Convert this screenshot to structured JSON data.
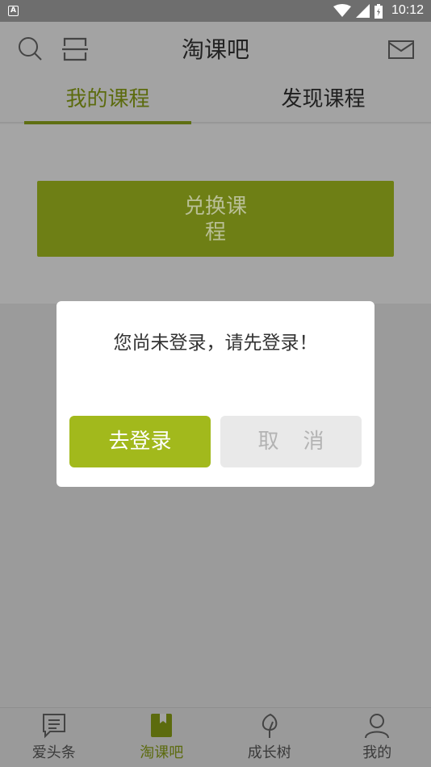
{
  "status_bar": {
    "app_indicator": "A",
    "time": "10:12",
    "icons": [
      "wifi-icon",
      "signal-icon",
      "battery-icon"
    ]
  },
  "header": {
    "title": "淘课吧",
    "left_icons": [
      "search-icon",
      "scan-icon"
    ],
    "right_icon": "mail-icon"
  },
  "tabs": [
    {
      "label": "我的课程",
      "active": true
    },
    {
      "label": "发现课程",
      "active": false
    }
  ],
  "content": {
    "redeem_button_label": "兑换课程"
  },
  "dialog": {
    "message": "您尚未登录，请先登录！",
    "confirm_label": "去登录",
    "cancel_label": "取消"
  },
  "bottom_nav": [
    {
      "label": "爱头条",
      "icon": "news-icon",
      "active": false
    },
    {
      "label": "淘课吧",
      "icon": "book-icon",
      "active": true
    },
    {
      "label": "成长树",
      "icon": "leaf-icon",
      "active": false
    },
    {
      "label": "我的",
      "icon": "user-icon",
      "active": false
    }
  ],
  "colors": {
    "accent": "#5c6b0e",
    "login_button": "#a2b91c",
    "redeem_button": "#6e7f15",
    "overlay": "#a3a3a3"
  }
}
